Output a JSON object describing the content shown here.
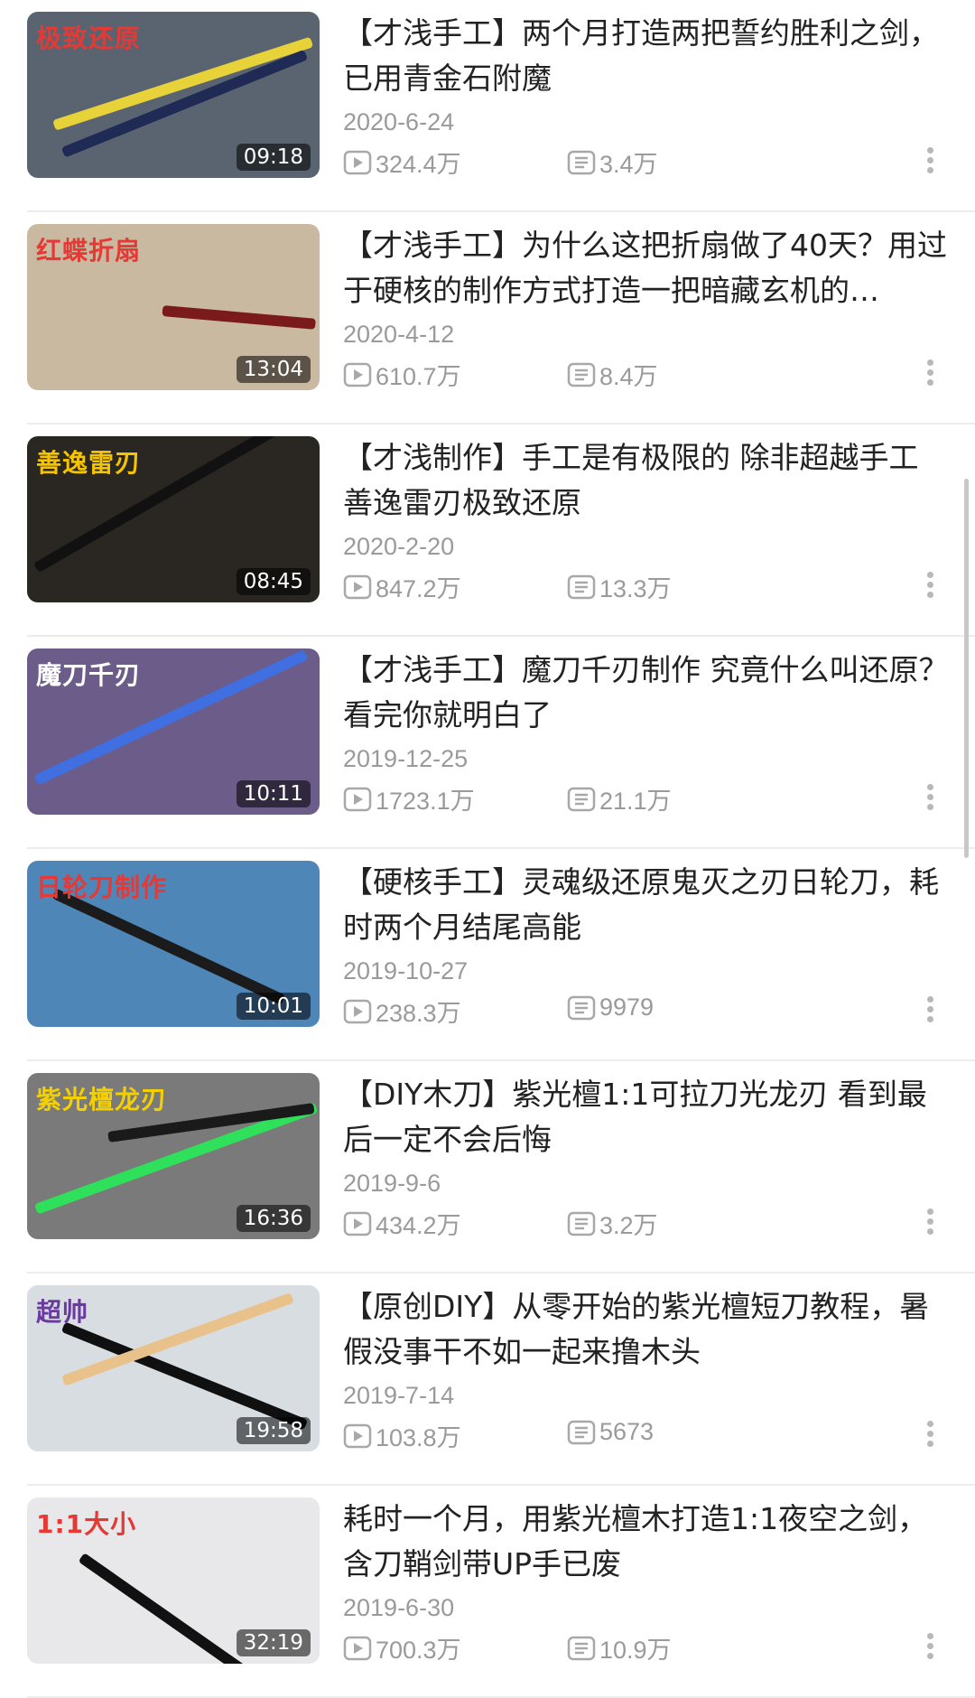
{
  "videos": [
    {
      "title": "【才浅手工】两个月打造两把誓约胜利之剑，已用青金石附魔",
      "date": "2020-6-24",
      "views": "324.4万",
      "danmaku": "3.4万",
      "duration": "09:18",
      "thumb_text": "极致还原",
      "thumb_text_color": "#e53935",
      "thumb_bg": "#5a6470"
    },
    {
      "title": "【才浅手工】为什么这把折扇做了40天？用过于硬核的制作方式打造一把暗藏玄机的…",
      "date": "2020-4-12",
      "views": "610.7万",
      "danmaku": "8.4万",
      "duration": "13:04",
      "thumb_text": "红蝶折扇",
      "thumb_text_color": "#e53935",
      "thumb_bg": "#c9b9a0"
    },
    {
      "title": "【才浅制作】手工是有极限的 除非超越手工 善逸雷刃极致还原",
      "date": "2020-2-20",
      "views": "847.2万",
      "danmaku": "13.3万",
      "duration": "08:45",
      "thumb_text": "善逸雷刃",
      "thumb_text_color": "#f5c400",
      "thumb_bg": "#2a2622"
    },
    {
      "title": "【才浅手工】魔刀千刃制作 究竟什么叫还原？看完你就明白了",
      "date": "2019-12-25",
      "views": "1723.1万",
      "danmaku": "21.1万",
      "duration": "10:11",
      "thumb_text": "魔刀千刃",
      "thumb_text_color": "#ffffff",
      "thumb_bg": "#6b5c8a"
    },
    {
      "title": "【硬核手工】灵魂级还原鬼灭之刃日轮刀，耗时两个月结尾高能",
      "date": "2019-10-27",
      "views": "238.3万",
      "danmaku": "9979",
      "duration": "10:01",
      "thumb_text": "日轮刀制作",
      "thumb_text_color": "#e53935",
      "thumb_bg": "#4f86b8"
    },
    {
      "title": "【DIY木刀】紫光檀1:1可拉刀光龙刃 看到最后一定不会后悔",
      "date": "2019-9-6",
      "views": "434.2万",
      "danmaku": "3.2万",
      "duration": "16:36",
      "thumb_text": "紫光檀龙刃",
      "thumb_text_color": "#f5d000",
      "thumb_bg": "#7a7a7a"
    },
    {
      "title": "【原创DIY】从零开始的紫光檀短刀教程，暑假没事干不如一起来撸木头",
      "date": "2019-7-14",
      "views": "103.8万",
      "danmaku": "5673",
      "duration": "19:58",
      "thumb_text": "超帅",
      "thumb_text_color": "#6a3aa0",
      "thumb_bg": "#d8dde2"
    },
    {
      "title": "耗时一个月，用紫光檀木打造1:1夜空之剑，含刀鞘剑带UP手已废",
      "date": "2019-6-30",
      "views": "700.3万",
      "danmaku": "10.9万",
      "duration": "32:19",
      "thumb_text": "1:1大小",
      "thumb_text_color": "#e53935",
      "thumb_bg": "#e8e8ea"
    }
  ]
}
